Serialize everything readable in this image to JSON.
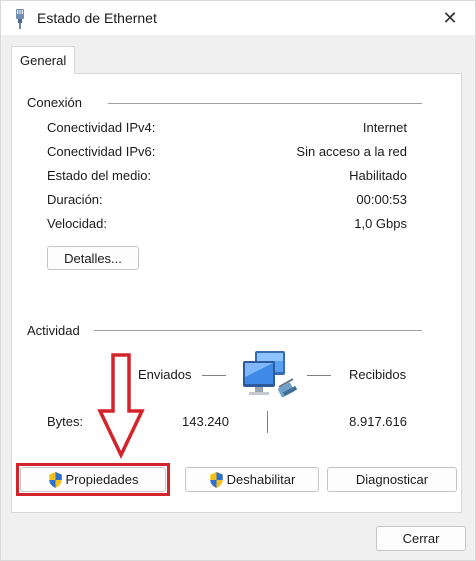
{
  "window": {
    "title": "Estado de Ethernet",
    "close_symbol": "✕"
  },
  "tab": {
    "label": "General"
  },
  "conexion": {
    "heading": "Conexión",
    "rows": [
      {
        "label": "Conectividad IPv4:",
        "value": "Internet"
      },
      {
        "label": "Conectividad IPv6:",
        "value": "Sin acceso a la red"
      },
      {
        "label": "Estado del medio:",
        "value": "Habilitado"
      },
      {
        "label": "Duración:",
        "value": "00:00:53"
      },
      {
        "label": "Velocidad:",
        "value": "1,0 Gbps"
      }
    ],
    "details_button": "Detalles..."
  },
  "actividad": {
    "heading": "Actividad",
    "sent_label": "Enviados",
    "received_label": "Recibidos",
    "bytes_label": "Bytes:",
    "bytes_sent": "143.240",
    "bytes_received": "8.917.616"
  },
  "buttons": {
    "properties": "Propiedades",
    "disable": "Deshabilitar",
    "diagnose": "Diagnosticar",
    "close": "Cerrar"
  },
  "icons": {
    "title": "ethernet-plug-icon",
    "network": "network-computers-icon",
    "shield": "uac-shield-icon",
    "annotation": "red-down-arrow"
  },
  "colors": {
    "highlight": "#d2242a",
    "accent": "#0a64c8"
  }
}
